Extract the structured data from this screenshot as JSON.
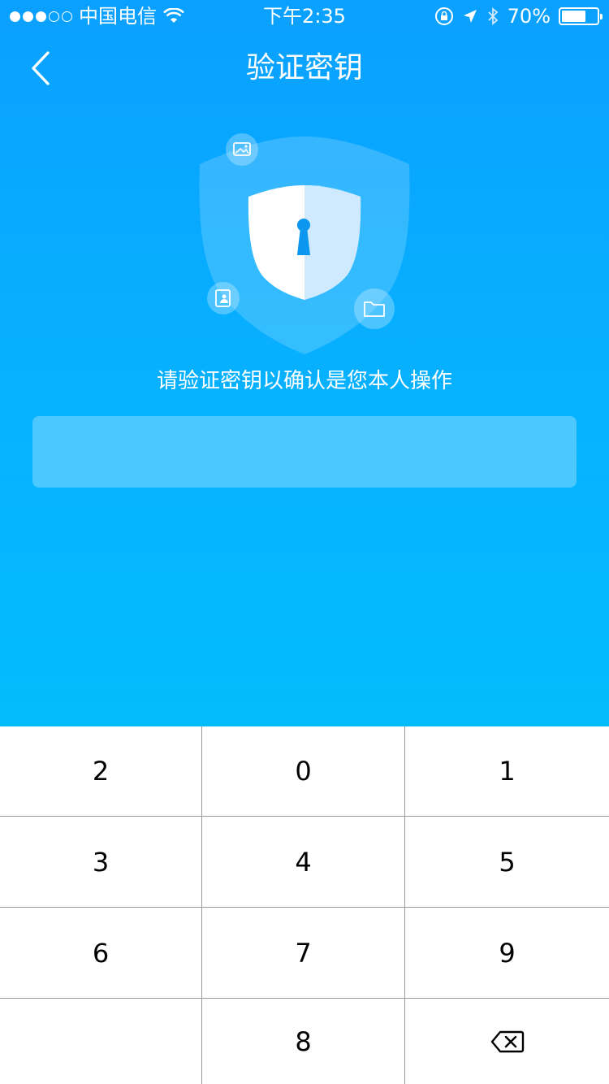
{
  "status_bar": {
    "carrier": "中国电信",
    "time": "下午2:35",
    "battery": "70%",
    "battery_level": 0.7
  },
  "nav": {
    "title": "验证密钥",
    "back_icon": "chevron-left-icon"
  },
  "illustration": {
    "icons": [
      "shield-icon",
      "keyhole-icon",
      "image-icon",
      "contact-icon",
      "folder-icon"
    ]
  },
  "prompt": "请验证密钥以确认是您本人操作",
  "key_field": {
    "value": ""
  },
  "keypad": {
    "keys": [
      "2",
      "0",
      "1",
      "3",
      "4",
      "5",
      "6",
      "7",
      "9",
      "",
      "8",
      "delete"
    ],
    "delete_icon": "backspace-icon"
  },
  "colors": {
    "gradient_top": "#0aa0ff",
    "gradient_bottom": "#02bcfd",
    "keypad_divider": "#9a9a9a"
  }
}
